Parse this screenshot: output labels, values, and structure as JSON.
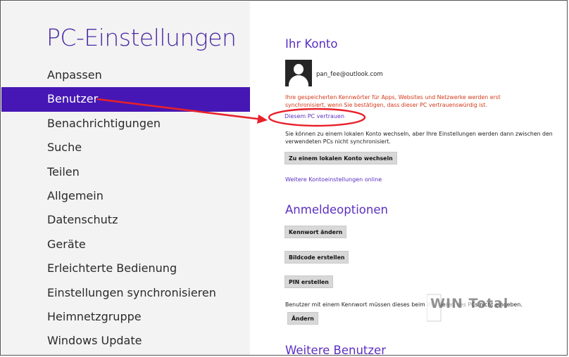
{
  "app": {
    "title": "PC-Einstellungen"
  },
  "sidebar": {
    "items": [
      {
        "label": "Anpassen"
      },
      {
        "label": "Benutzer",
        "selected": true
      },
      {
        "label": "Benachrichtigungen"
      },
      {
        "label": "Suche"
      },
      {
        "label": "Teilen"
      },
      {
        "label": "Allgemein"
      },
      {
        "label": "Datenschutz"
      },
      {
        "label": "Geräte"
      },
      {
        "label": "Erleichterte Bedienung"
      },
      {
        "label": "Einstellungen synchronisieren"
      },
      {
        "label": "Heimnetzgruppe"
      },
      {
        "label": "Windows Update"
      }
    ]
  },
  "account": {
    "heading": "Ihr Konto",
    "email": "pan_fee@outlook.com",
    "warning": "Ihre gespeicherten Kennwörter für Apps, Websites und Netzwerke werden erst synchronisiert, wenn Sie bestätigen, dass dieser PC vertrauenswürdig ist.",
    "trust_link": "Diesem PC vertrauen",
    "local_info": "Sie können zu einem lokalen Konto wechseln, aber Ihre Einstellungen werden dann zwischen den verwendeten PCs nicht synchronisiert.",
    "switch_button": "Zu einem lokalen Konto wechseln",
    "more_link": "Weitere Kontoeinstellungen online"
  },
  "signin": {
    "heading": "Anmeldeoptionen",
    "change_password": "Kennwort ändern",
    "picture_password": "Bildcode erstellen",
    "pin": "PIN erstellen",
    "policy_text": "Benutzer mit einem Kennwort müssen dieses beim Aktivieren des PCs nicht eingeben.",
    "change_button": "Ändern"
  },
  "other_users": {
    "heading": "Weitere Benutzer"
  },
  "watermark": {
    "text": "WIN Total"
  },
  "colors": {
    "accent": "#4617b4",
    "warning": "#d13a1a",
    "annotation": "#e8202a"
  }
}
